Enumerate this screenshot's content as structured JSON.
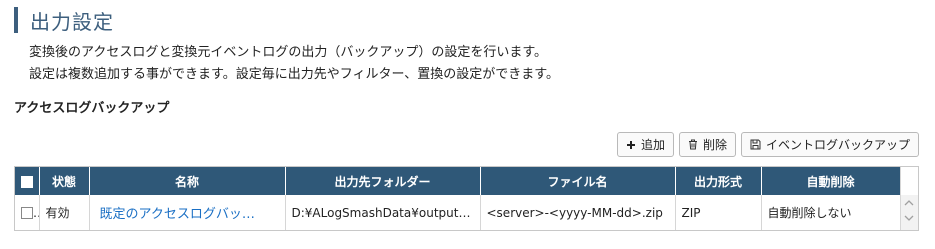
{
  "page": {
    "title": "出力設定",
    "description_line1": "変換後のアクセスログと変換元イベントログの出力（バックアップ）の設定を行います。",
    "description_line2": "設定は複数追加する事ができます。設定毎に出力先やフィルター、置換の設定ができます。"
  },
  "section": {
    "title": "アクセスログバックアップ"
  },
  "toolbar": {
    "add_label": "追加",
    "delete_label": "削除",
    "event_backup_label": "イベントログバックアップ"
  },
  "table": {
    "columns": [
      "状態",
      "名称",
      "出力先フォルダー",
      "ファイル名",
      "出力形式",
      "自動削除"
    ],
    "rows": [
      {
        "status": "有効",
        "name": "既定のアクセスログバッ…",
        "folder": "D:¥ALogSmashData¥output…",
        "filename": "<server>-<yyyy-MM-dd>.zip",
        "format": "ZIP",
        "auto_delete": "自動削除しない"
      }
    ]
  },
  "colors": {
    "accent": "#3d5f7e",
    "header_bg": "#2f5878",
    "link": "#1a6fc4"
  }
}
